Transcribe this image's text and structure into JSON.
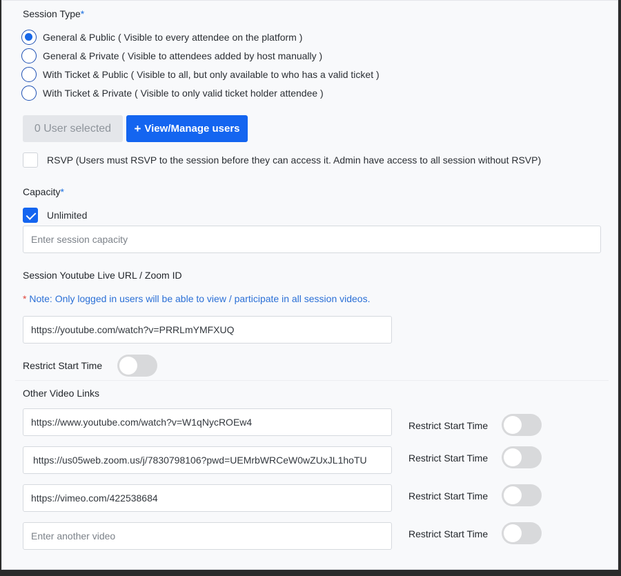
{
  "session_type": {
    "label": "Session Type",
    "required_mark": "*",
    "options": [
      {
        "label": "General & Public ( Visible to every attendee on the platform )",
        "selected": true
      },
      {
        "label": "General & Private ( Visible to attendees added by host manually )",
        "selected": false
      },
      {
        "label": "With Ticket & Public ( Visible to all, but only available to who has a valid ticket )",
        "selected": false
      },
      {
        "label": "With Ticket & Private ( Visible to only valid ticket holder attendee )",
        "selected": false
      }
    ]
  },
  "users": {
    "selected_label": "0 User selected",
    "manage_label": "View/Manage users",
    "manage_icon": "plus-icon"
  },
  "rsvp": {
    "label": "RSVP (Users must RSVP to the session before they can access it. Admin have access to all session without RSVP)",
    "checked": false
  },
  "capacity": {
    "label": "Capacity",
    "required_mark": "*",
    "unlimited_label": "Unlimited",
    "unlimited_checked": true,
    "placeholder": "Enter session capacity"
  },
  "live_url": {
    "label": "Session Youtube Live URL / Zoom ID",
    "note_star": "*",
    "note": "Note: Only logged in users will be able to view / participate in all session videos.",
    "value": "https://youtube.com/watch?v=PRRLmYMFXUQ",
    "restrict_label": "Restrict Start Time",
    "restrict_on": false
  },
  "other_videos": {
    "label": "Other Video Links",
    "restrict_label": "Restrict Start Time",
    "items": [
      {
        "value": "https://www.youtube.com/watch?v=W1qNycROEw4",
        "restrict_on": false
      },
      {
        "value": "https://us05web.zoom.us/j/7830798106?pwd=UEMrbWRCeW0wZUxJL1hoTU",
        "restrict_on": false
      },
      {
        "value": "https://vimeo.com/422538684",
        "restrict_on": false
      }
    ],
    "placeholder": "Enter another video"
  },
  "colors": {
    "accent": "#1465f0",
    "note": "#2a6fd6",
    "required_star": "#e0463b"
  }
}
